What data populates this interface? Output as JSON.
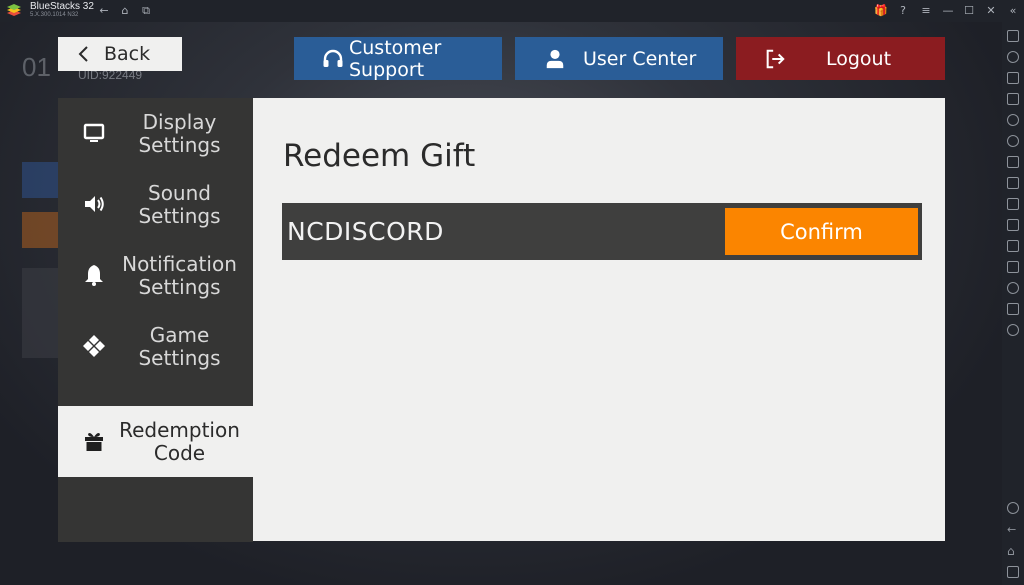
{
  "window": {
    "title": "BlueStacks 32",
    "version": "5.X.300.1014 N32",
    "controls": [
      "gift-icon",
      "help-icon",
      "menu-icon",
      "minimize-icon",
      "restore-icon",
      "close-icon",
      "collapse-icon"
    ]
  },
  "background": {
    "level": "01",
    "uid": "UID:922449"
  },
  "header": {
    "back_label": "Back",
    "customer_support_label": "Customer Support",
    "user_center_label": "User Center",
    "logout_label": "Logout"
  },
  "sidebar": {
    "items": [
      {
        "label": "Display\nSettings",
        "icon": "monitor-icon"
      },
      {
        "label": "Sound\nSettings",
        "icon": "speaker-icon"
      },
      {
        "label": "Notification\nSettings",
        "icon": "bell-icon"
      },
      {
        "label": "Game\nSettings",
        "icon": "gamepad-icon"
      },
      {
        "label": "Redemption\nCode",
        "icon": "gift-icon"
      }
    ],
    "active_index": 4
  },
  "panel": {
    "title": "Redeem Gift",
    "code_value": "NCDISCORD",
    "confirm_label": "Confirm"
  },
  "colors": {
    "accent_orange": "#fb8500",
    "blue_button": "#2a5d97",
    "red_button": "#8b1c20",
    "sidebar_bg": "#353534",
    "panel_bg": "#f0f0ef"
  }
}
